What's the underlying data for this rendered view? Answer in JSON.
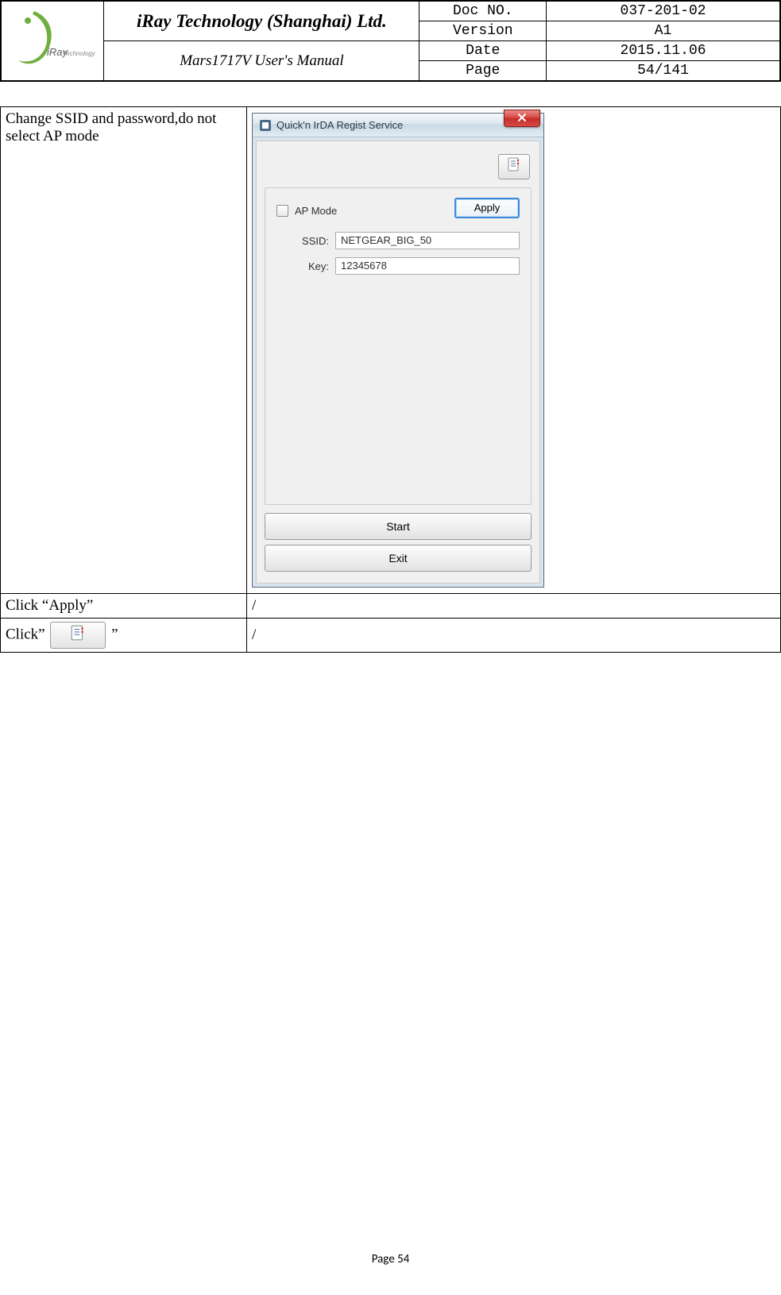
{
  "header": {
    "company": "iRay Technology (Shanghai) Ltd.",
    "logo_text": "iRay",
    "logo_sub": "Technology",
    "subtitle": "Mars1717V User's Manual",
    "meta": {
      "doc_no_label": "Doc NO.",
      "doc_no": "037-201-02",
      "version_label": "Version",
      "version": "A1",
      "date_label": "Date",
      "date": "2015.11.06",
      "page_label": "Page",
      "page": "54/141"
    }
  },
  "table": {
    "row1_left": "Change SSID and password,do not select AP mode",
    "dialog": {
      "title": "Quick'n IrDA Regist Service",
      "ap_mode_label": "AP Mode",
      "apply_label": "Apply",
      "ssid_label": "SSID:",
      "ssid_value": "NETGEAR_BIG_50",
      "key_label": "Key:",
      "key_value": "12345678",
      "start_label": "Start",
      "exit_label": "Exit"
    },
    "row2_left": "Click “Apply”",
    "row2_right": "/",
    "row3_left_prefix": "Click”",
    "row3_left_suffix": "”",
    "row3_right": "/"
  },
  "footer": "Page 54"
}
